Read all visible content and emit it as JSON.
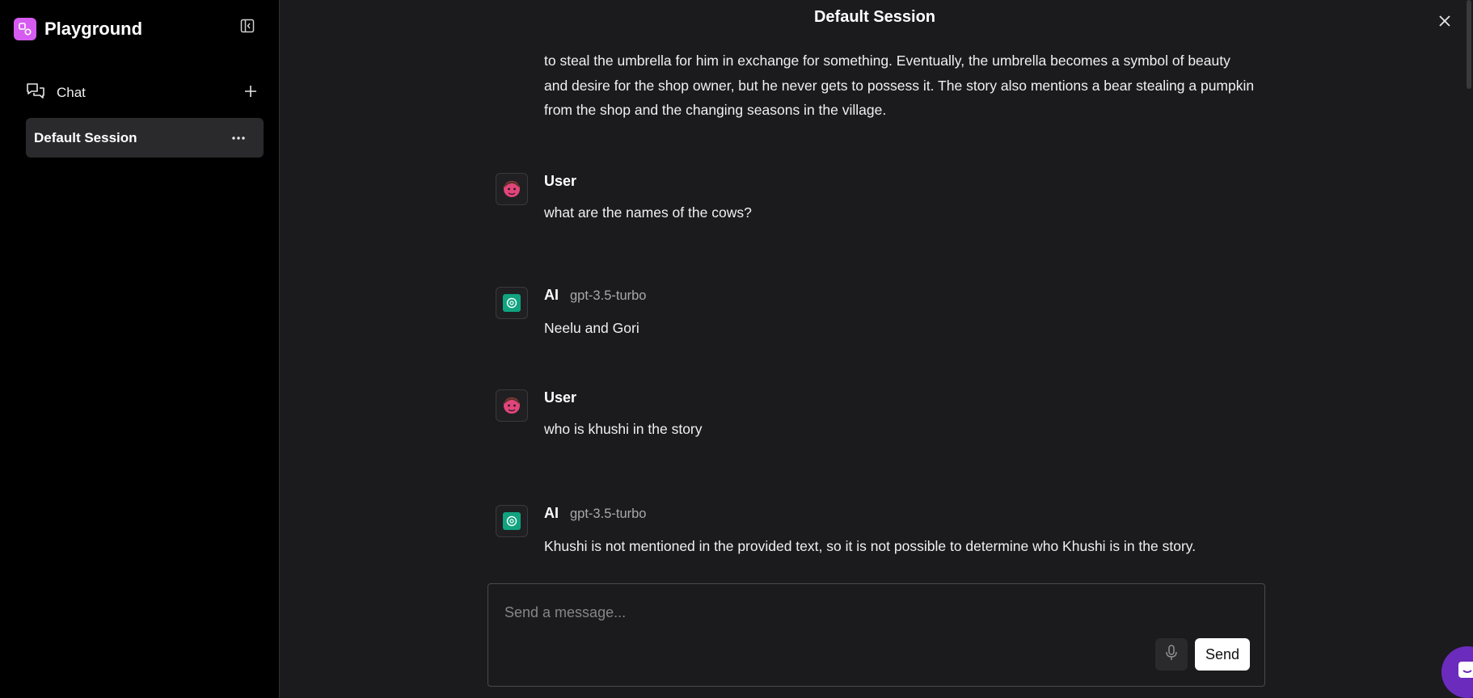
{
  "sidebar": {
    "app_name": "Playground",
    "nav_chat_label": "Chat",
    "sessions": [
      {
        "label": "Default Session"
      }
    ]
  },
  "header": {
    "title": "Default Session"
  },
  "conversation": {
    "partial_text": "to steal the umbrella for him in exchange for something. Eventually, the umbrella becomes a symbol of beauty and desire for the shop owner, but he never gets to possess it. The story also mentions a bear stealing a pumpkin from the shop and the changing seasons in the village.",
    "messages": [
      {
        "role": "User",
        "model": "",
        "text": "what are the names of the cows?"
      },
      {
        "role": "AI",
        "model": "gpt-3.5-turbo",
        "text": "Neelu and Gori"
      },
      {
        "role": "User",
        "model": "",
        "text": "who is khushi in the story"
      },
      {
        "role": "AI",
        "model": "gpt-3.5-turbo",
        "text": "Khushi is not mentioned in the provided text, so it is not possible to determine who Khushi is in the story."
      }
    ]
  },
  "composer": {
    "placeholder": "Send a message...",
    "value": "",
    "send_label": "Send"
  },
  "icons": {
    "brand": "playground-logo-icon",
    "collapse": "sidebar-collapse-icon",
    "chat": "chat-bubbles-icon",
    "add": "plus-icon",
    "more": "ellipsis-icon",
    "close": "close-icon",
    "user_avatar": "user-avatar-icon",
    "ai_avatar": "openai-icon",
    "mic": "microphone-icon",
    "help": "chat-support-icon"
  },
  "colors": {
    "brand": "#d65bf0",
    "ai_avatar": "#10a37f",
    "user_avatar": "#e0457b",
    "help_bubble": "#6b2bbd"
  }
}
